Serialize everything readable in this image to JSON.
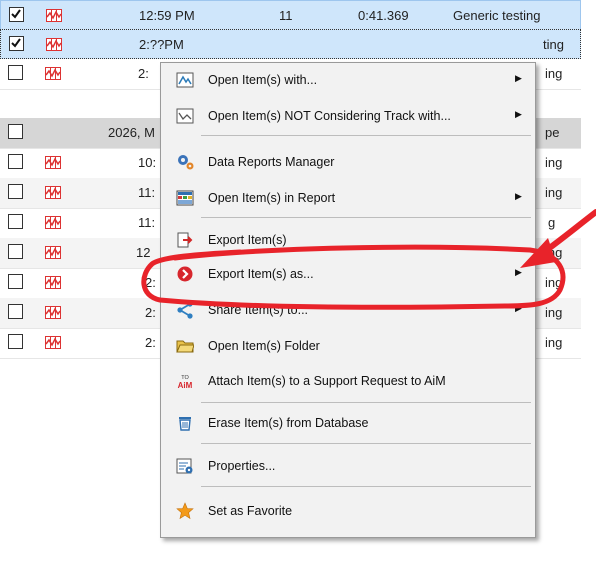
{
  "rows": [
    {
      "checked": true,
      "time": "12:59 PM",
      "laps": "11",
      "best": "0:41.369",
      "championship": "Generic testing",
      "style": "sel r0",
      "icon": "red"
    },
    {
      "checked": true,
      "time": "2:??PM",
      "laps": "",
      "best": "",
      "championship": "",
      "style": "sel r1",
      "icon": "red"
    },
    {
      "checked": false,
      "time": "2:",
      "laps": "",
      "best": "",
      "championship": "",
      "style": "",
      "icon": "red"
    },
    {
      "checked": false,
      "time": "2026, M",
      "laps": "",
      "best": "",
      "championship": "",
      "style": "grp",
      "icon": "none"
    },
    {
      "checked": false,
      "time": "10:",
      "laps": "",
      "best": "",
      "championship": "",
      "style": "",
      "icon": "red"
    },
    {
      "checked": false,
      "time": "11:",
      "laps": "",
      "best": "",
      "championship": "",
      "style": "alt",
      "icon": "red"
    },
    {
      "checked": false,
      "time": "11:",
      "laps": "",
      "best": "",
      "championship": "",
      "style": "",
      "icon": "red"
    },
    {
      "checked": false,
      "time": "12",
      "laps": "",
      "best": "",
      "championship": "",
      "style": "alt",
      "icon": "red"
    },
    {
      "checked": false,
      "time": "2:",
      "laps": "",
      "best": "",
      "championship": "",
      "style": "",
      "icon": "red"
    },
    {
      "checked": false,
      "time": "2:",
      "laps": "",
      "best": "",
      "championship": "",
      "style": "alt",
      "icon": "red"
    },
    {
      "checked": false,
      "time": "2:",
      "laps": "",
      "best": "",
      "championship": "",
      "style": "",
      "icon": "red"
    }
  ],
  "row_fragments": [
    "ting",
    "ing",
    "pe",
    "ing",
    "ing",
    "g",
    "ing",
    "ing",
    "ing",
    "ing"
  ],
  "context_menu": {
    "items": [
      {
        "label": "Open Item(s) with...",
        "icon": "open-with-icon",
        "submenu": true
      },
      {
        "label": "Open Item(s) NOT Considering Track with...",
        "icon": "open-no-track-icon",
        "submenu": true
      },
      {
        "label": "Data Reports Manager",
        "icon": "gears-icon",
        "submenu": false
      },
      {
        "label": "Open Item(s) in Report",
        "icon": "report-icon",
        "submenu": true
      },
      {
        "label": "Export Item(s)",
        "icon": "export-icon",
        "submenu": false
      },
      {
        "label": "Export Item(s) as...",
        "icon": "export-as-icon",
        "submenu": true
      },
      {
        "label": "Share Item(s) to...",
        "icon": "share-icon",
        "submenu": true
      },
      {
        "label": "Open Item(s) Folder",
        "icon": "folder-icon",
        "submenu": false
      },
      {
        "label": "Attach Item(s) to a Support Request to AiM",
        "icon": "aim-icon",
        "submenu": false
      },
      {
        "label": "Erase Item(s) from Database",
        "icon": "trash-icon",
        "submenu": false
      },
      {
        "label": "Properties...",
        "icon": "properties-icon",
        "submenu": false
      },
      {
        "label": "Set as Favorite",
        "icon": "star-icon",
        "submenu": false
      }
    ],
    "aim_icon_text": {
      "top": "TO",
      "bottom": "AiM"
    }
  },
  "annotation_color": "#e8232a"
}
